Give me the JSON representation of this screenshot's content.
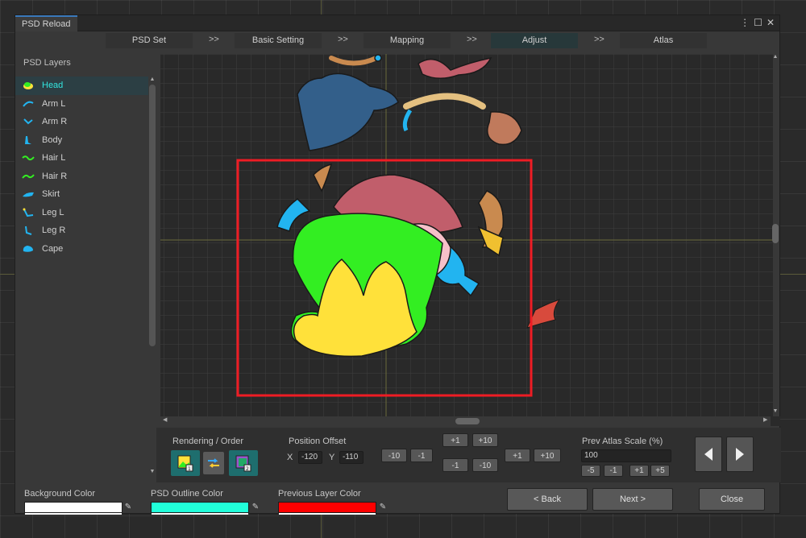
{
  "window": {
    "title": "PSD Reload",
    "icons": [
      "more-icon",
      "maximize-icon",
      "close-icon"
    ]
  },
  "steps": {
    "items": [
      {
        "label": "PSD Set"
      },
      {
        "label": "Basic Setting"
      },
      {
        "label": "Mapping"
      },
      {
        "label": "Adjust",
        "active": true
      },
      {
        "label": "Atlas"
      }
    ],
    "separator": ">>"
  },
  "layers": {
    "title": "PSD Layers",
    "items": [
      {
        "label": "Head",
        "selected": true
      },
      {
        "label": "Arm L"
      },
      {
        "label": "Arm R"
      },
      {
        "label": "Body"
      },
      {
        "label": "Hair L"
      },
      {
        "label": "Hair R"
      },
      {
        "label": "Skirt"
      },
      {
        "label": "Leg L"
      },
      {
        "label": "Leg R"
      },
      {
        "label": "Cape"
      }
    ]
  },
  "controls": {
    "rendering_label": "Rendering / Order",
    "position_label": "Position Offset",
    "x_label": "X",
    "x_value": "-120",
    "y_label": "Y",
    "y_value": "-110",
    "offset_buttons": {
      "left10": "-10",
      "left1": "-1",
      "up1": "+1",
      "up10": "+10",
      "down1": "-1",
      "down10": "-10",
      "right1": "+1",
      "right10": "+10"
    },
    "scale_label": "Prev Atlas Scale (%)",
    "scale_value": "100",
    "scale_buttons": [
      "-5",
      "-1",
      "+1",
      "+5"
    ]
  },
  "footer": {
    "background_color_label": "Background Color",
    "background_color": "#ffffff",
    "outline_color_label": "PSD Outline Color",
    "outline_color": "#21ffd9",
    "previous_color_label": "Previous Layer Color",
    "previous_color": "#ff0000",
    "back_label": "< Back",
    "next_label": "Next >",
    "close_label": "Close"
  },
  "colors": {
    "accent": "#33e6e0",
    "selection_rect": "#ee1c24",
    "head_fill": "#ffe13a",
    "hair_green": "#33ee22",
    "hair_red": "#c15e6b",
    "ribbon_blue": "#22b4f0",
    "cape_blue": "#335f8a"
  }
}
